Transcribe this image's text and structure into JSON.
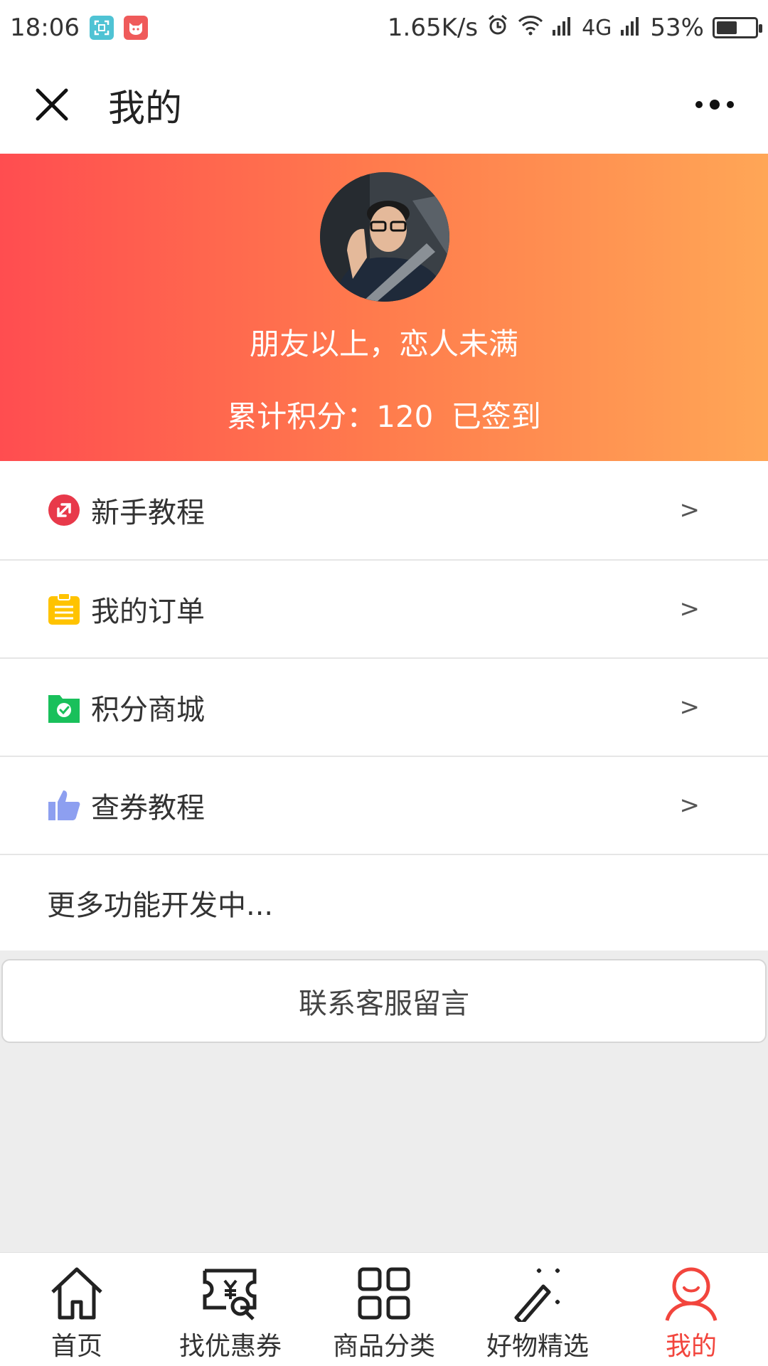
{
  "status_bar": {
    "time": "18:06",
    "speed": "1.65K/s",
    "network": "4G",
    "battery": "53%",
    "battery_level": 0.53
  },
  "header": {
    "title": "我的"
  },
  "profile": {
    "username": "朋友以上，恋人未满",
    "points_label": "累计积分：120",
    "checkin_status": "已签到"
  },
  "menu": {
    "items": [
      {
        "label": "新手教程",
        "arrow": ">",
        "icon": "tutorial-icon",
        "color": "#e8394a"
      },
      {
        "label": "我的订单",
        "arrow": ">",
        "icon": "clipboard-icon",
        "color": "#ffc300"
      },
      {
        "label": "积分商城",
        "arrow": ">",
        "icon": "folder-check-icon",
        "color": "#19c05b"
      },
      {
        "label": "查券教程",
        "arrow": ">",
        "icon": "thumbs-up-icon",
        "color": "#8d9ff0"
      }
    ],
    "more": "更多功能开发中..."
  },
  "contact_button": "联系客服留言",
  "tabbar": {
    "items": [
      {
        "label": "首页",
        "icon": "home-icon"
      },
      {
        "label": "找优惠券",
        "icon": "coupon-search-icon"
      },
      {
        "label": "商品分类",
        "icon": "grid-icon"
      },
      {
        "label": "好物精选",
        "icon": "magic-wand-icon"
      },
      {
        "label": "我的",
        "icon": "user-icon",
        "active": true
      }
    ],
    "active_color": "#f2453d"
  },
  "colors": {
    "gradient_start": "#ff4d50",
    "gradient_end": "#ffa656"
  }
}
